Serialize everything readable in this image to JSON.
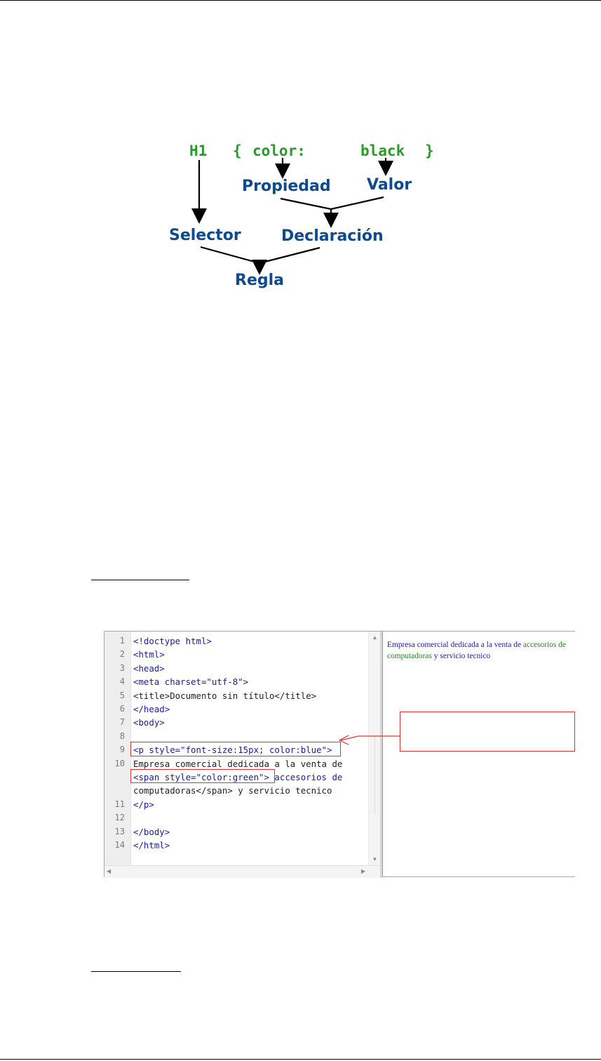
{
  "diagram": {
    "code": {
      "selector": "H1",
      "open_brace": "{",
      "property": "color:",
      "value": "black",
      "close_brace": "}"
    },
    "labels": {
      "propiedad": "Propiedad",
      "valor": "Valor",
      "selector": "Selector",
      "declaracion": "Declaración",
      "regla": "Regla"
    }
  },
  "editor": {
    "line_numbers": [
      "1",
      "2",
      "3",
      "4",
      "5",
      "6",
      "7",
      "8",
      "9",
      "10",
      "",
      "",
      "11",
      "12",
      "13",
      "14"
    ],
    "lines": [
      "<!doctype html>",
      "<html>",
      "<head>",
      "<meta charset=\"utf-8\">",
      "<title>Documento sin título</title>",
      "</head>",
      "<body>",
      "",
      "<p style=\"font-size:15px; color:blue\">",
      "Empresa comercial dedicada a la venta de",
      "<span style=\"color:green\"> accesorios de",
      "computadoras</span> y servicio tecnico",
      "</p>",
      "",
      "</body>",
      "</html>"
    ],
    "scroll_up_icon": "triangle-up",
    "scroll_down_icon": "triangle-down",
    "scroll_left_icon": "triangle-left",
    "scroll_right_icon": "triangle-right"
  },
  "preview": {
    "text_blue_1": "Empresa comercial dedicada a la venta de",
    "text_green": "accesorios de computadoras",
    "text_blue_2": "y servicio tecnico",
    "colors": {
      "blue": "#1a1ac8",
      "green": "#1e8c1e"
    }
  },
  "callout": {
    "color": "#e53030",
    "text": ""
  }
}
